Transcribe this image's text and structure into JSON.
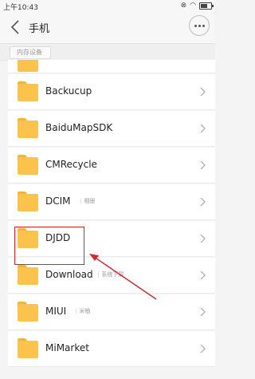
{
  "status_bar": {
    "time": "上午10:43"
  },
  "header": {
    "title": "手机"
  },
  "breadcrumb": {
    "current": "内存设备"
  },
  "folders": [
    {
      "name": "Backucup",
      "subtitle": ""
    },
    {
      "name": "BaiduMapSDK",
      "subtitle": ""
    },
    {
      "name": "CMRecycle",
      "subtitle": ""
    },
    {
      "name": "DCIM",
      "subtitle": "相册"
    },
    {
      "name": "DJDD",
      "subtitle": ""
    },
    {
      "name": "Download",
      "subtitle": "系统下载"
    },
    {
      "name": "MIUI",
      "subtitle": "米柚"
    },
    {
      "name": "MiMarket",
      "subtitle": ""
    }
  ],
  "colors": {
    "folder": "#fbc24c",
    "annotation": "#d8262b"
  }
}
